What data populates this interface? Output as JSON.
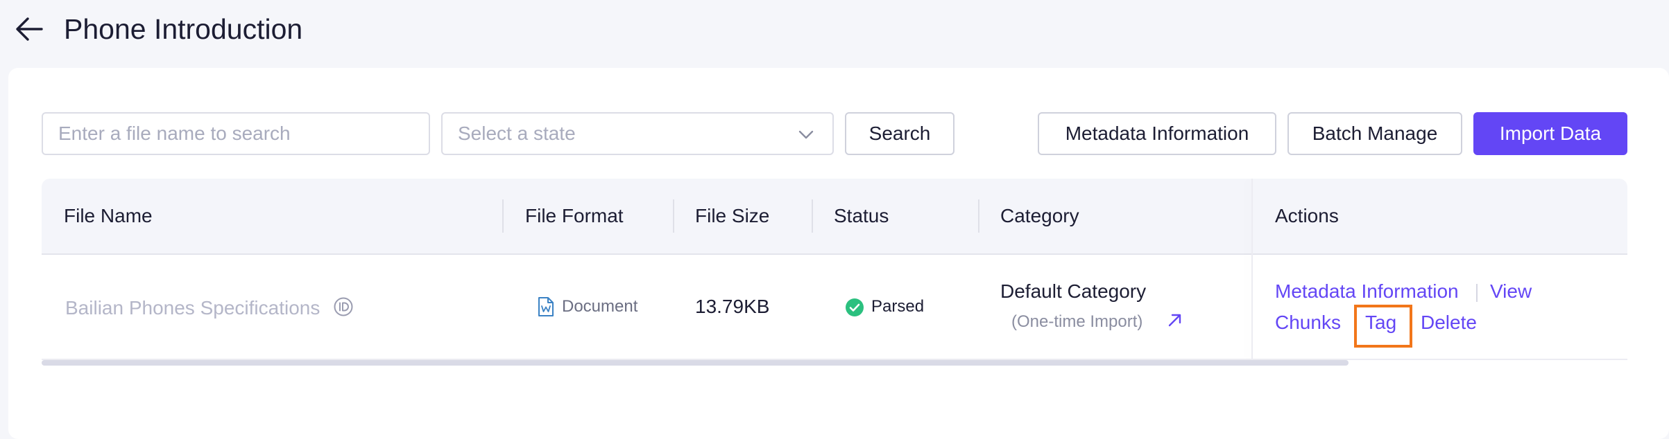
{
  "header": {
    "title": "Phone Introduction"
  },
  "toolbar": {
    "search_placeholder": "Enter a file name to search",
    "state_placeholder": "Select a state",
    "search_label": "Search",
    "metadata_label": "Metadata Information",
    "batch_label": "Batch Manage",
    "import_label": "Import Data"
  },
  "table": {
    "headers": {
      "file_name": "File Name",
      "file_format": "File Format",
      "file_size": "File Size",
      "status": "Status",
      "category": "Category",
      "actions": "Actions"
    },
    "rows": [
      {
        "file_name": "Bailian Phones Specifications",
        "format": "Document",
        "size": "13.79KB",
        "status": "Parsed",
        "category": "Default Category",
        "category_sub": "(One-time Import)",
        "actions": {
          "metadata": "Metadata Information",
          "view": "View",
          "chunks": "Chunks",
          "tag": "Tag",
          "delete": "Delete"
        }
      }
    ]
  },
  "colors": {
    "accent": "#6346f5",
    "status_parsed": "#2bc07f",
    "highlight": "#f2761a"
  },
  "icons": {
    "back": "arrow-left-icon",
    "dropdown": "chevron-down-icon",
    "id_badge": "id-icon",
    "format": "document-icon",
    "status": "check-circle-icon",
    "category_link": "arrow-up-right-icon"
  }
}
